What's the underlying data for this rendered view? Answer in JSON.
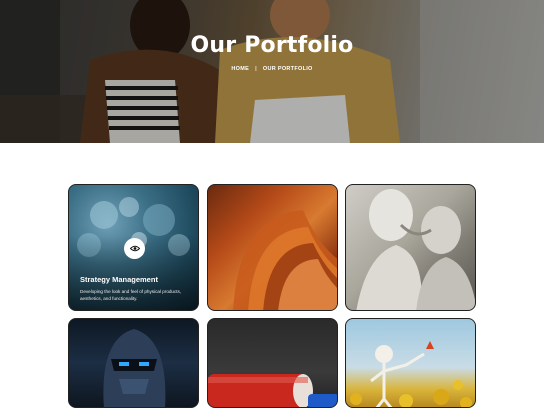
{
  "header": {
    "title": "Our Portfolio",
    "breadcrumb": {
      "home": "HOME",
      "separator": "|",
      "current": "OUR PORTFOLIO"
    }
  },
  "portfolio": {
    "items": [
      {
        "title": "Strategy Management",
        "description": "Developing the look and feel of physical products, aesthetics, and functionality.",
        "icon": "eye-icon"
      },
      {
        "image": "orange-abstract-spiral"
      },
      {
        "image": "marble-statues"
      },
      {
        "image": "robot-helmet"
      },
      {
        "image": "red-tube-object"
      },
      {
        "image": "skeleton-sunflowers"
      }
    ]
  },
  "colors": {
    "hero_text": "#ffffff",
    "card_border": "#222222",
    "page_background": "#ffffff"
  }
}
